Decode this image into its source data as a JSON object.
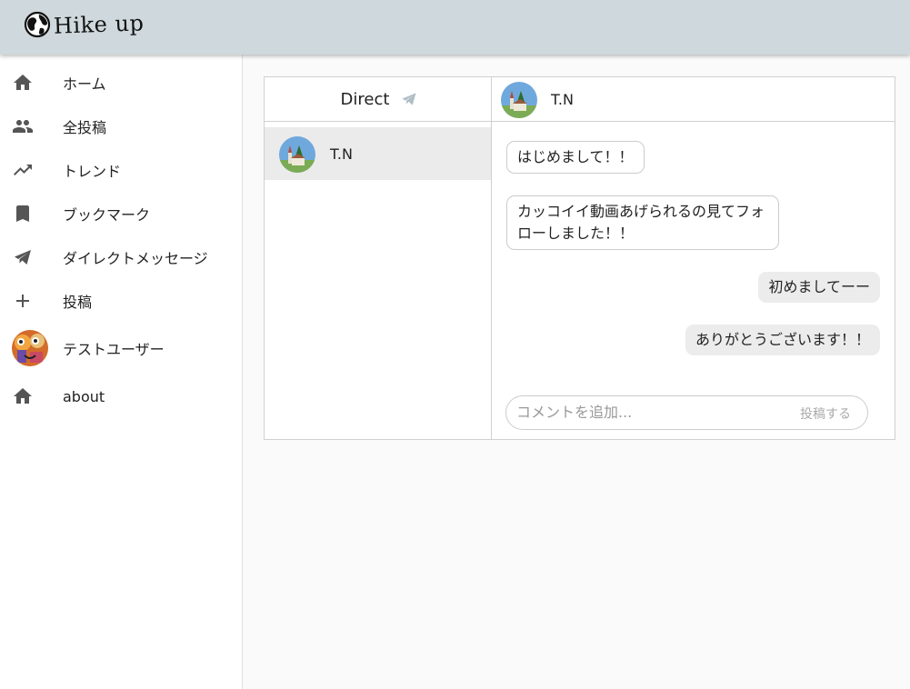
{
  "app": {
    "title": "Hike up"
  },
  "sidebar": {
    "items": [
      {
        "label": "ホーム",
        "icon": "home-icon"
      },
      {
        "label": "全投稿",
        "icon": "people-icon"
      },
      {
        "label": "トレンド",
        "icon": "trending-icon"
      },
      {
        "label": "ブックマーク",
        "icon": "bookmark-icon"
      },
      {
        "label": "ダイレクトメッセージ",
        "icon": "send-icon"
      },
      {
        "label": "投稿",
        "icon": "plus-icon"
      },
      {
        "label": "テストユーザー",
        "icon": "user-avatar"
      },
      {
        "label": "about",
        "icon": "home-icon"
      }
    ]
  },
  "direct": {
    "title": "Direct",
    "conversations": [
      {
        "name": "T.N"
      }
    ]
  },
  "chat": {
    "partner": "T.N",
    "messages": [
      {
        "text": "はじめまして！！",
        "direction": "incoming"
      },
      {
        "text": "カッコイイ動画あげられるの見てフォローしました！！",
        "direction": "incoming"
      },
      {
        "text": "初めましてーー",
        "direction": "outgoing"
      },
      {
        "text": "ありがとうございます！！",
        "direction": "outgoing"
      }
    ],
    "input_placeholder": "コメントを追加...",
    "input_value": "",
    "post_label": "投稿する"
  },
  "colors": {
    "appbar": "#cfd8dc",
    "icon": "#555555",
    "selected": "#ebebeb",
    "outgoing_bubble": "#ececec",
    "send_icon_header": "#b0bec5"
  }
}
